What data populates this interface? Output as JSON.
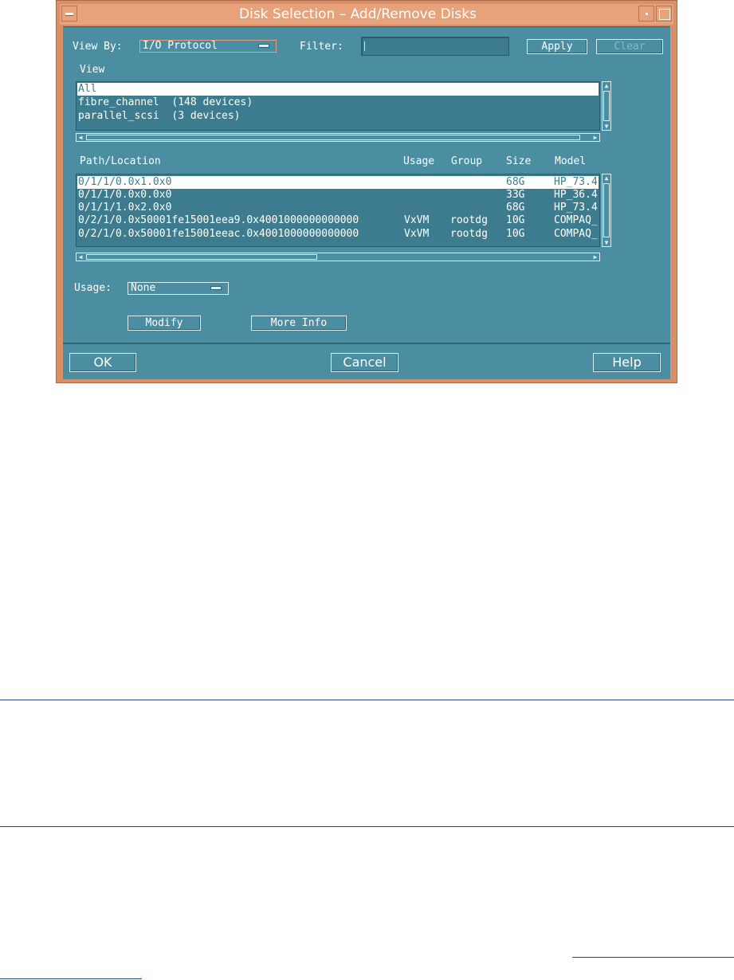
{
  "window": {
    "title": "Disk Selection – Add/Remove Disks"
  },
  "toolbar": {
    "view_by_label": "View By:",
    "view_by_value": "I/O Protocol",
    "filter_label": "Filter:",
    "filter_value": "",
    "apply_label": "Apply",
    "clear_label": "Clear"
  },
  "view_list": {
    "label": "View",
    "items": [
      "All",
      "fibre_channel  (148 devices)",
      "parallel_scsi  (3 devices)"
    ],
    "selected_index": 0
  },
  "disk_table": {
    "columns": [
      "Path/Location",
      "Usage",
      "Group",
      "Size",
      "Model"
    ],
    "rows": [
      {
        "path": "0/1/1/0.0x1.0x0",
        "usage": "",
        "group": "",
        "size": "68G",
        "model": "HP_73.4"
      },
      {
        "path": "0/1/1/0.0x0.0x0",
        "usage": "",
        "group": "",
        "size": "33G",
        "model": "HP_36.4"
      },
      {
        "path": "0/1/1/1.0x2.0x0",
        "usage": "",
        "group": "",
        "size": "68G",
        "model": "HP_73.4"
      },
      {
        "path": "0/2/1/0.0x50001fe15001eea9.0x4001000000000000",
        "usage": "VxVM",
        "group": "rootdg",
        "size": "10G",
        "model": "COMPAQ_"
      },
      {
        "path": "0/2/1/0.0x50001fe15001eeac.0x4001000000000000",
        "usage": "VxVM",
        "group": "rootdg",
        "size": "10G",
        "model": "COMPAQ_"
      }
    ],
    "selected_index": 0
  },
  "usage_control": {
    "label": "Usage:",
    "value": "None"
  },
  "actions": {
    "modify_label": "Modify",
    "more_info_label": "More Info"
  },
  "footer": {
    "ok_label": "OK",
    "cancel_label": "Cancel",
    "help_label": "Help"
  },
  "colors": {
    "panel": "#4b8ea1",
    "list_bg": "#3d7c8e",
    "frame": "#d9906a",
    "rule": "#1e4a7a"
  }
}
